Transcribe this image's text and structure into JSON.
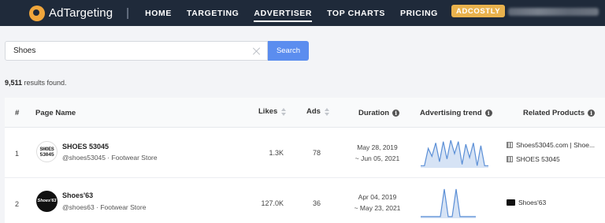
{
  "brand": {
    "name": "AdTargeting"
  },
  "nav": {
    "separator": "|",
    "items": [
      {
        "label": "HOME"
      },
      {
        "label": "TARGETING"
      },
      {
        "label": "ADVERTISER"
      },
      {
        "label": "TOP CHARTS"
      },
      {
        "label": "PRICING"
      }
    ],
    "active": "ADVERTISER",
    "badge": "ADCOSTLY"
  },
  "search": {
    "value": "Shoes",
    "button": "Search"
  },
  "results": {
    "count": "9,511",
    "suffix": " results found."
  },
  "table": {
    "headers": {
      "index": "#",
      "page_name": "Page Name",
      "likes": "Likes",
      "ads": "Ads",
      "duration": "Duration",
      "trend": "Advertising trend",
      "related": "Related Products"
    },
    "rows": [
      {
        "index": "1",
        "avatar_text": "SHOES 53045",
        "title": "SHOES 53045",
        "subtitle": "@shoes53045 · Footwear Store",
        "likes": "1.3K",
        "ads": "78",
        "duration_start": "May 28, 2019",
        "duration_end": "~ Jun 05, 2021",
        "trend": [
          0.05,
          0.05,
          0.7,
          0.4,
          0.9,
          0.2,
          0.95,
          0.3,
          1.0,
          0.5,
          0.95,
          0.1,
          0.85,
          0.35,
          0.9,
          0.05,
          0.8,
          0.05,
          0.05
        ],
        "related": [
          {
            "icon": "qr-icon",
            "label": "Shoes53045.com | Shoe..."
          },
          {
            "icon": "qr-icon",
            "label": "SHOES 53045"
          }
        ]
      },
      {
        "index": "2",
        "avatar_text": "Shoes'63",
        "title": "Shoes'63",
        "subtitle": "@shoes63 · Footwear Store",
        "likes": "127.0K",
        "ads": "36",
        "duration_start": "Apr 04, 2019",
        "duration_end": "~ May 23, 2021",
        "trend": [
          0.03,
          0.03,
          0.03,
          0.03,
          0.03,
          0.03,
          1.0,
          0.03,
          0.03,
          1.0,
          0.03,
          0.03,
          0.03,
          0.03,
          0.03
        ],
        "related": [
          {
            "icon": "brand-thumb-icon",
            "label": "Shoes'63"
          }
        ]
      }
    ]
  },
  "colors": {
    "nav_bg": "#1f2a3a",
    "accent": "#5b8def",
    "badge": "#e9b24d",
    "trend_line": "#5b8fd6"
  }
}
